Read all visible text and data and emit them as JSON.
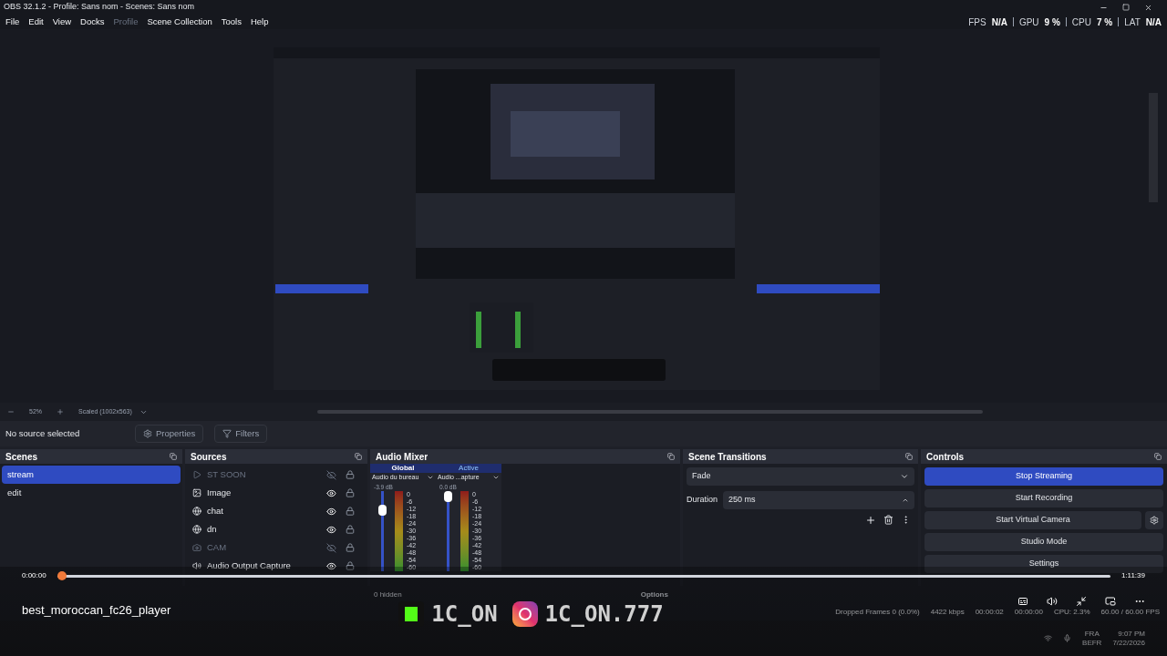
{
  "window": {
    "title": "OBS 32.1.2 - Profile: Sans nom - Scenes: Sans nom"
  },
  "menu": [
    {
      "label": "File",
      "disabled": false
    },
    {
      "label": "Edit",
      "disabled": false
    },
    {
      "label": "View",
      "disabled": false
    },
    {
      "label": "Docks",
      "disabled": false
    },
    {
      "label": "Profile",
      "disabled": true
    },
    {
      "label": "Scene Collection",
      "disabled": false
    },
    {
      "label": "Tools",
      "disabled": false
    },
    {
      "label": "Help",
      "disabled": false
    }
  ],
  "stats": [
    {
      "label": "FPS",
      "value": "N/A"
    },
    {
      "label": "GPU",
      "value": "9 %"
    },
    {
      "label": "CPU",
      "value": "7 %"
    },
    {
      "label": "LAT",
      "value": "N/A"
    }
  ],
  "zoom_bar": {
    "zoom": "52%",
    "scale": "Scaled (1002x563)"
  },
  "source_bar": {
    "status": "No source selected",
    "buttons": [
      {
        "label": "Properties",
        "kind": "gear"
      },
      {
        "label": "Filters",
        "kind": "filter"
      }
    ]
  },
  "scenes": {
    "title": "Scenes",
    "items": [
      {
        "label": "stream",
        "selected": true
      },
      {
        "label": "edit",
        "selected": false
      }
    ]
  },
  "sources": {
    "title": "Sources",
    "items": [
      {
        "label": "ST SOON",
        "kind": "media",
        "visible": false
      },
      {
        "label": "Image",
        "visible": true
      },
      {
        "label": "chat",
        "kind": "browser",
        "visible": true
      },
      {
        "label": "dn",
        "kind": "browser",
        "visible": true
      },
      {
        "label": "CAM",
        "kind": "camera",
        "visible": false
      },
      {
        "label": "Audio Output Capture",
        "kind": "audio",
        "visible": true
      }
    ]
  },
  "audio_mixer": {
    "title": "Audio Mixer",
    "tabs": [
      {
        "label": "Global",
        "selected": true
      },
      {
        "label": "Active",
        "selected": false
      }
    ],
    "channels": [
      {
        "name": "Audio du bureau",
        "reading": "-3.9 dB",
        "level": 0.8,
        "scale": [
          "0",
          "-6",
          "-12",
          "-18",
          "-24",
          "-30",
          "-36",
          "-42",
          "-48",
          "-54",
          "-60"
        ]
      },
      {
        "name": "Audio ...apture",
        "reading": "0.0 dB",
        "level": 1,
        "scale": [
          "0",
          "-6",
          "-12",
          "-18",
          "-24",
          "-30",
          "-36",
          "-42",
          "-48",
          "-54",
          "-60"
        ]
      }
    ],
    "hidden": "0 hidden",
    "options": "Options"
  },
  "scene_transitions": {
    "title": "Scene Transitions",
    "transition": "Fade",
    "duration_label": "Duration",
    "duration": "250 ms"
  },
  "controls": {
    "title": "Controls",
    "buttons": [
      {
        "label": "Stop Streaming",
        "active": true,
        "kind": "plain"
      },
      {
        "label": "Start Recording",
        "active": false,
        "kind": "plain"
      },
      {
        "label": "Start Virtual Camera",
        "active": false,
        "kind": "gear"
      },
      {
        "label": "Studio Mode",
        "active": false,
        "kind": "plain"
      },
      {
        "label": "Settings",
        "active": false,
        "kind": "plain"
      }
    ]
  },
  "status_bar": [
    "Dropped Frames 0 (0.0%)",
    "4422 kbps",
    "00:00:02",
    "00:00:00",
    "CPU: 2.3%",
    "60.00 / 60.00 FPS"
  ],
  "taskbar": {
    "language": "FRA",
    "layout": "BEFR",
    "time": "9:07 PM",
    "date": "7/22/2026"
  },
  "player": {
    "title": "best_moroccan_fc26_player",
    "elapsed": "0:00:00",
    "duration": "1:11:39",
    "level": 0
  },
  "banner": [
    {
      "kind": "kick",
      "text": "1C_ON"
    },
    {
      "kind": "instagram",
      "text": "1C_ON.777"
    }
  ]
}
